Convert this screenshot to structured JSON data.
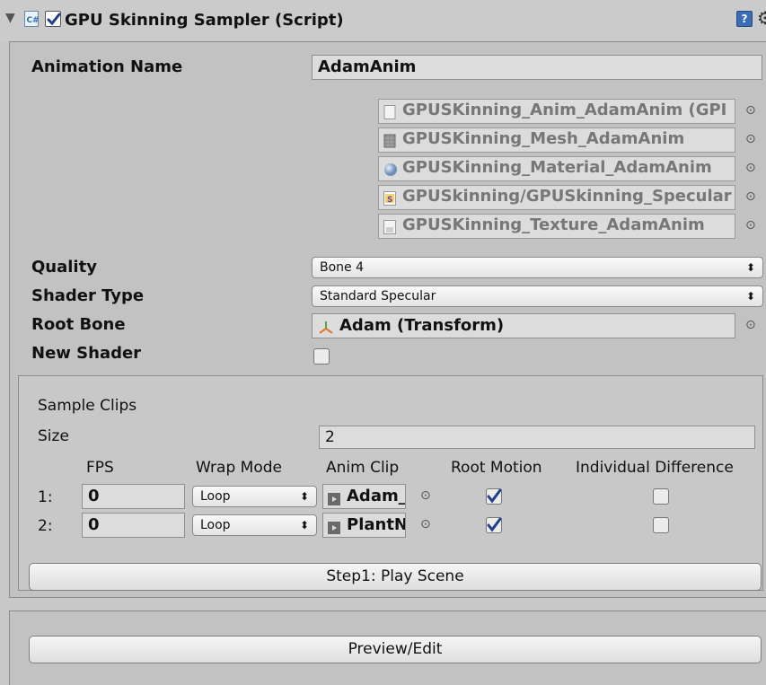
{
  "header": {
    "title": "GPU Skinning Sampler (Script)",
    "enabled": true,
    "fold_glyph": "▼",
    "help_glyph": "?",
    "gear_glyph": "⚙"
  },
  "fields": {
    "animation_name_label": "Animation Name",
    "animation_name_value": "AdamAnim",
    "quality_label": "Quality",
    "quality_value": "Bone 4",
    "shader_type_label": "Shader Type",
    "shader_type_value": "Standard Specular",
    "root_bone_label": "Root Bone",
    "root_bone_value": "Adam (Transform)",
    "new_shader_label": "New Shader",
    "new_shader_checked": false
  },
  "assets": [
    {
      "icon": "text-asset-icon",
      "label": "GPUSKinning_Anim_AdamAnim (GPI"
    },
    {
      "icon": "mesh-icon",
      "label": "GPUSKinning_Mesh_AdamAnim"
    },
    {
      "icon": "material-icon",
      "label": "GPUSKinning_Material_AdamAnim"
    },
    {
      "icon": "shader-icon",
      "label": "GPUSkinning/GPUSkinning_Specular"
    },
    {
      "icon": "texture-icon",
      "label": "GPUSKinning_Texture_AdamAnim"
    }
  ],
  "clips": {
    "section_label": "Sample Clips",
    "size_label": "Size",
    "size_value": "2",
    "columns": [
      "FPS",
      "Wrap Mode",
      "Anim Clip",
      "Root Motion",
      "Individual Difference"
    ],
    "rows": [
      {
        "index": "1:",
        "fps": "0",
        "wrap": "Loop",
        "clip": "Adam_",
        "root_motion": true,
        "individual": false
      },
      {
        "index": "2:",
        "fps": "0",
        "wrap": "Loop",
        "clip": "PlantN",
        "root_motion": true,
        "individual": false
      }
    ]
  },
  "buttons": {
    "step1": "Step1: Play Scene",
    "preview": "Preview/Edit"
  },
  "glyphs": {
    "picker": "⊙",
    "dropdown_arrow": "⬍"
  },
  "colors": {
    "panel_bg": "#c2c2c2",
    "help_icon_blue": "#3a6db5",
    "bone_icon_orange": "#e0782a"
  }
}
